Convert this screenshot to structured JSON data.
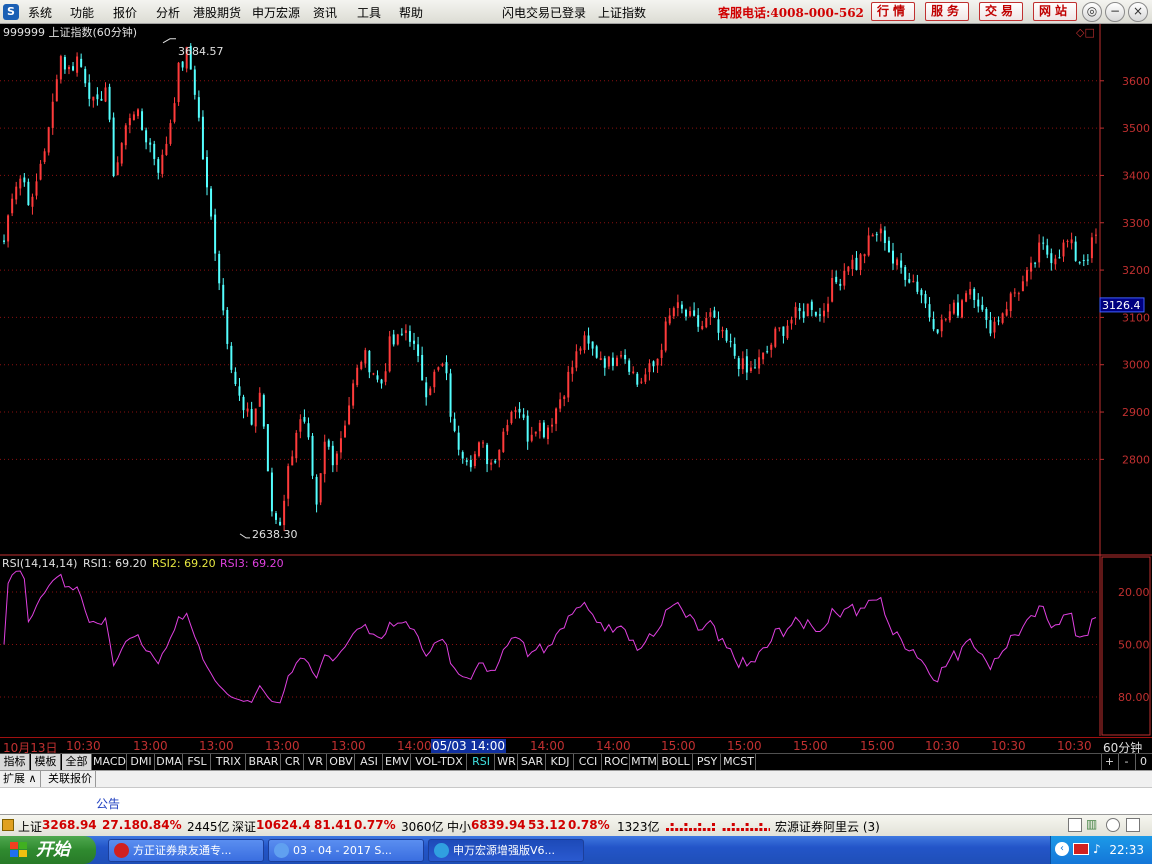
{
  "menubar": {
    "items": [
      "系统",
      "功能",
      "报价",
      "分析",
      "港股期货",
      "申万宏源",
      "资讯",
      "工具",
      "帮助"
    ],
    "login_status": "闪电交易已登录",
    "current_symbol": "上证指数",
    "hotline": "客服电话:4008-000-562",
    "buttons": [
      "行情",
      "服务",
      "交易",
      "网站"
    ]
  },
  "chart": {
    "title": "999999 上证指数(60分钟)",
    "high_label": "3684.57",
    "low_label": "2638.30",
    "last_price": "3126.4",
    "price_ticks": [
      "3600",
      "3500",
      "3400",
      "3300",
      "3200",
      "3100",
      "3000",
      "2900",
      "2800"
    ],
    "rsi_label": "RSI(14,14,14)",
    "rsi1": "RSI1: 69.20",
    "rsi2": "RSI2: 69.20",
    "rsi3": "RSI3: 69.20",
    "rsi_ticks": [
      "80.00",
      "50.00",
      "20.00"
    ],
    "colors": {
      "up": "#ff3b3b",
      "down": "#54ffff",
      "rsi": "#e040e0",
      "grid": "#8a1010",
      "axis": "#c03030"
    }
  },
  "chart_data": {
    "type": "candlestick",
    "title": "999999 上证指数(60分钟)",
    "ylim": [
      2600,
      3720
    ],
    "y_ticks": [
      2800,
      2900,
      3000,
      3100,
      3200,
      3300,
      3400,
      3500,
      3600
    ],
    "high": 3684.57,
    "low": 2638.3,
    "last": 3126.4,
    "close_path": [
      3260,
      3380,
      3400,
      3330,
      3430,
      3500,
      3660,
      3620,
      3650,
      3600,
      3530,
      3600,
      3400,
      3480,
      3550,
      3500,
      3460,
      3410,
      3500,
      3620,
      3660,
      3560,
      3380,
      3250,
      3100,
      2980,
      2900,
      2880,
      2950,
      2700,
      2660,
      2780,
      2880,
      2860,
      2680,
      2840,
      2800,
      2870,
      2950,
      3020,
      3000,
      2950,
      3040,
      3050,
      3080,
      3010,
      2950,
      2980,
      3000,
      2850,
      2820,
      2800,
      2830,
      2790,
      2830,
      2900,
      2920,
      2850,
      2880,
      2860,
      2900,
      2950,
      3000,
      3050,
      3030,
      3020,
      3000,
      3040,
      3010,
      2960,
      2980,
      3000,
      3070,
      3120,
      3110,
      3090,
      3080,
      3100,
      3060,
      3040,
      3010,
      2980,
      3000,
      3020,
      3060,
      3080,
      3100,
      3110,
      3130,
      3100,
      3160,
      3180,
      3220,
      3210,
      3250,
      3280,
      3270,
      3210,
      3200,
      3180,
      3150,
      3100,
      3080,
      3110,
      3120,
      3170,
      3150,
      3080,
      3090,
      3120,
      3150,
      3170,
      3200,
      3250,
      3230,
      3240,
      3260,
      3220,
      3230,
      3270
    ],
    "rsi_ylim": [
      0,
      100
    ],
    "rsi_ticks": [
      20,
      50,
      80
    ],
    "rsi_series": [
      {
        "name": "RSI1",
        "last": 69.2
      },
      {
        "name": "RSI2",
        "last": 69.2
      },
      {
        "name": "RSI3",
        "last": 69.2
      }
    ],
    "x_ticks": [
      "10月13日",
      "10:30",
      "13:00",
      "13:00",
      "13:00",
      "13:00",
      "14:00",
      "05/03 14:00",
      "14:00",
      "14:00",
      "15:00",
      "15:00",
      "15:00",
      "15:00",
      "10:30",
      "10:30",
      "10:30"
    ],
    "period": "60分钟"
  },
  "indicators": {
    "zh_tabs": [
      "指标",
      "模板",
      "全部"
    ],
    "tabs": [
      "MACD",
      "DMI",
      "DMA",
      "FSL",
      "TRIX",
      "BRAR",
      "CR",
      "VR",
      "OBV",
      "ASI",
      "EMV",
      "VOL-TDX",
      "RSI",
      "WR",
      "SAR",
      "KDJ",
      "CCI",
      "ROC",
      "MTM",
      "BOLL",
      "PSY",
      "MCST"
    ],
    "active": "RSI",
    "plus": "+",
    "minus": "-",
    "zero": "0"
  },
  "subtabs": [
    "扩展 ∧",
    "关联报价"
  ],
  "notice": "公告",
  "status": {
    "sh_name": "上证",
    "sh_value": "3268.94",
    "sh_change": "27.18",
    "sh_pct": "0.84%",
    "sh_amount": "2445亿",
    "sz_name": "深证",
    "sz_value": "10624.4",
    "sz_change": "81.41",
    "sz_pct": "0.77%",
    "sz_amount": "3060亿",
    "zx_name": "中小",
    "zx_value": "6839.94",
    "zx_change": "53.12",
    "zx_pct": "0.78%",
    "zx_amount": "1323亿",
    "broker": "宏源证券阿里云 (3)"
  },
  "taskbar": {
    "start": "开始",
    "tasks": [
      "方正证券泉友通专...",
      "03 - 04 - 2017 S...",
      "申万宏源增强版V6..."
    ],
    "clock": "22:33"
  }
}
